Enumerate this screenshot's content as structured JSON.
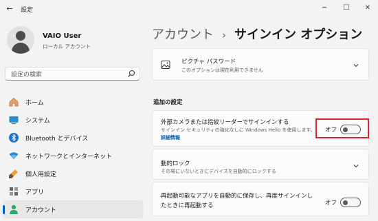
{
  "window": {
    "back_glyph": "←",
    "title": "設定",
    "minimize_glyph": "─",
    "maximize_glyph": "☐",
    "close_glyph": "✕"
  },
  "profile": {
    "name": "VAIO User",
    "account_type": "ローカル アカウント"
  },
  "search": {
    "placeholder": "設定の検索",
    "icon": "search-icon"
  },
  "sidebar": {
    "items": [
      {
        "label": "ホーム",
        "icon": "home-icon",
        "selected": false
      },
      {
        "label": "システム",
        "icon": "system-icon",
        "selected": false
      },
      {
        "label": "Bluetooth とデバイス",
        "icon": "bluetooth-icon",
        "selected": false
      },
      {
        "label": "ネットワークとインターネット",
        "icon": "wifi-icon",
        "selected": false
      },
      {
        "label": "個人用設定",
        "icon": "brush-icon",
        "selected": false
      },
      {
        "label": "アプリ",
        "icon": "apps-icon",
        "selected": false
      },
      {
        "label": "アカウント",
        "icon": "account-icon",
        "selected": true
      }
    ]
  },
  "breadcrumb": {
    "parent": "アカウント",
    "separator": "›",
    "current": "サインイン オプション"
  },
  "picture_password": {
    "title": "ピクチャ パスワード",
    "description": "このオプションは現在利用できません",
    "icon": "image-icon"
  },
  "additional_settings": {
    "section_title": "追加の設定",
    "external_camera": {
      "title": "外部カメラまたは指紋リーダーでサインインする",
      "description": "サインイン セキュリティの強化なしに Windows Hello を使用します。",
      "link": "詳細情報",
      "toggle_label": "オフ",
      "toggle_on": false
    },
    "dynamic_lock": {
      "title": "動的ロック",
      "description": "その場にいないときにデバイスを自動的にロックする"
    },
    "restart_apps": {
      "title_line1": "再起動可能なアプリを自動的に保存し、再度サインインし",
      "title_line2": "たときに再起動する",
      "toggle_label": "オフ",
      "toggle_on": false
    }
  },
  "colors": {
    "accent": "#005fb8",
    "highlight": "#e0242b",
    "background": "#f3f3f3",
    "card": "#fbfbfb"
  }
}
